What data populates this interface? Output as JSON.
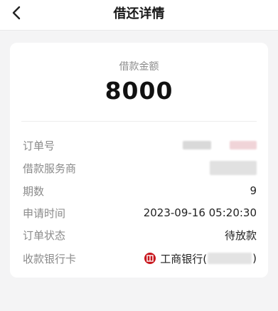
{
  "header": {
    "title": "借还详情",
    "back_icon": "chevron-left-icon"
  },
  "loan": {
    "amount_label": "借款金额",
    "amount_value": "8000"
  },
  "details": {
    "order_no": {
      "label": "订单号",
      "value": ""
    },
    "service_provider": {
      "label": "借款服务商",
      "value": ""
    },
    "periods": {
      "label": "期数",
      "value": "9"
    },
    "apply_time": {
      "label": "申请时间",
      "value": "2023-09-16 05:20:30"
    },
    "order_status": {
      "label": "订单状态",
      "value": "待放款"
    },
    "bank_card": {
      "label": "收款银行卡",
      "bank_name": "工商银行(",
      "close_paren": ")",
      "bank_icon": "icbc-icon",
      "icon_color": "#c8161d"
    }
  }
}
